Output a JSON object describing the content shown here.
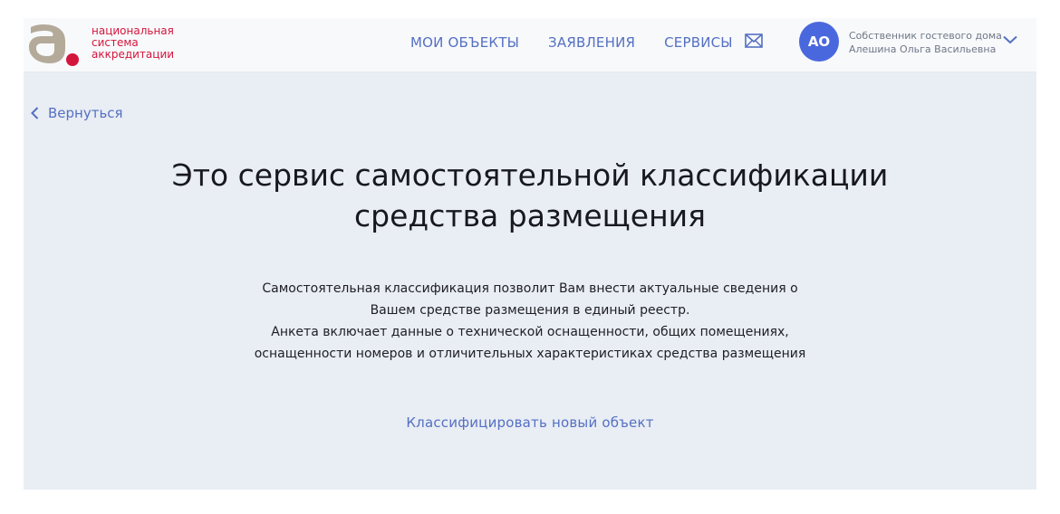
{
  "logo": {
    "lines": [
      "национальная",
      "система",
      "аккредитации"
    ],
    "colors": {
      "mark": "#b4aa9a",
      "dot": "#d4163c",
      "text": "#d4163c"
    }
  },
  "nav": [
    {
      "label": "МОИ ОБЪЕКТЫ"
    },
    {
      "label": "ЗАЯВЛЕНИЯ"
    },
    {
      "label": "СЕРВИСЫ"
    }
  ],
  "mail_icon": "envelope-icon",
  "user": {
    "initials": "АО",
    "role": "Собственник гостевого дома",
    "name": "Алешина Ольга Васильевна",
    "menu_icon": "chevron-down-icon"
  },
  "back": {
    "label": "Вернуться",
    "icon": "chevron-left-icon"
  },
  "title": {
    "line1": "Это сервис самостоятельной классификации",
    "line2": "средства размещения"
  },
  "description": [
    "Самостоятельная классификация позволит Вам внести актуальные сведения о",
    "Вашем средстве размещения в единый реестр.",
    "Анкета включает данные о технической оснащенности, общих помещениях,",
    "оснащенности номеров и отличительных характеристиках средства размещения"
  ],
  "cta": {
    "label": "Классифицировать новый объект"
  },
  "colors": {
    "accent": "#5470c2",
    "avatar": "#4a68de",
    "background": "#e9edf4",
    "header": "#f8f9fb"
  }
}
